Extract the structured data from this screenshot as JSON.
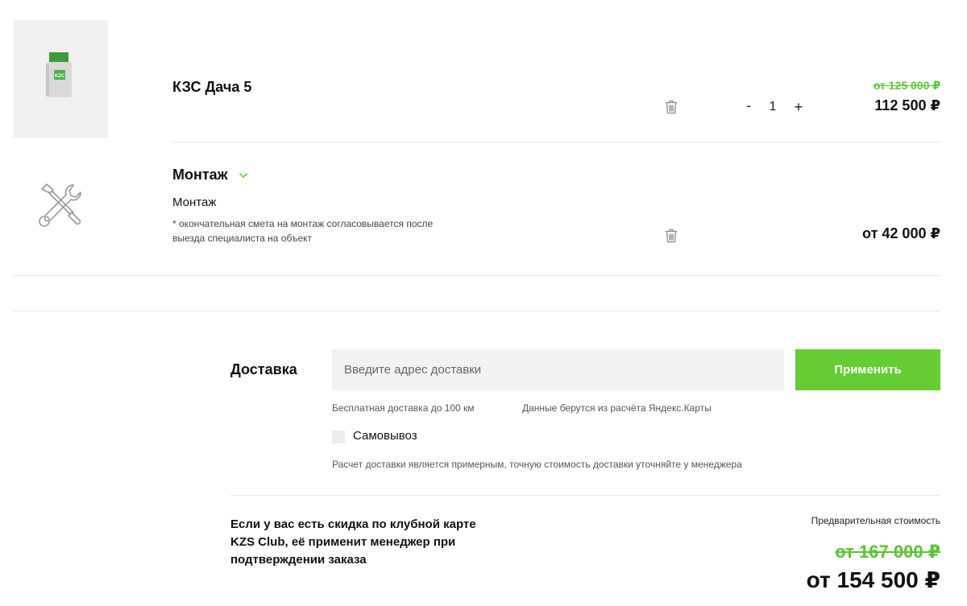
{
  "cart": {
    "items": [
      {
        "title": "КЗС Дача 5",
        "image_label": "KZC",
        "old_price": "от 125 000 ₽",
        "price": "112 500 ₽",
        "quantity": "1",
        "qty_minus": "-",
        "qty_plus": "+"
      }
    ],
    "service": {
      "title": "Монтаж",
      "subtitle": "Монтаж",
      "note": "* окончательная смета на монтаж согласовывается после выезда специалиста на объект",
      "price": "от 42 000 ₽"
    }
  },
  "delivery": {
    "label": "Доставка",
    "address_placeholder": "Введите адрес доставки",
    "address_value": "",
    "apply_label": "Применить",
    "hint_free": "Бесплатная доставка до 100 км",
    "hint_source": "Данные берутся из расчёта Яндекс.Карты",
    "pickup_label": "Самовывоз",
    "pickup_checked": false,
    "disclaimer": "Расчет доставки является примерным, точную стоимость доставки уточняйте у менеджера"
  },
  "summary": {
    "club_text": "Если у вас есть скидка по клубной карте KZS Club, её применит менеджер при подтверждении заказа",
    "pre_cost_label": "Предварительная стоимость",
    "old_total": "от 167 000 ₽",
    "total": "от 154 500 ₽"
  },
  "colors": {
    "accent": "#66cc33",
    "old_price": "#5bc436"
  }
}
